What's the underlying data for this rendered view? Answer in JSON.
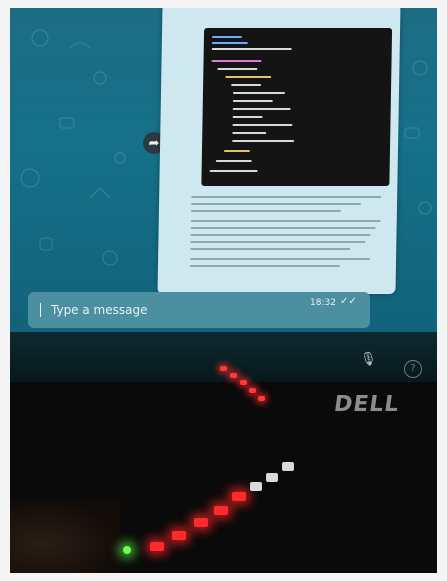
{
  "chat": {
    "input_placeholder": "Type a message",
    "timestamp": "18:32",
    "status_ticks": "✓✓"
  },
  "laptop": {
    "brand": "DELL"
  },
  "colors": {
    "screen": "#157089",
    "bubble": "#cfe7ee",
    "code_bg": "#141414",
    "led_red": "#ff2b2b",
    "led_green": "#6bff4f"
  }
}
